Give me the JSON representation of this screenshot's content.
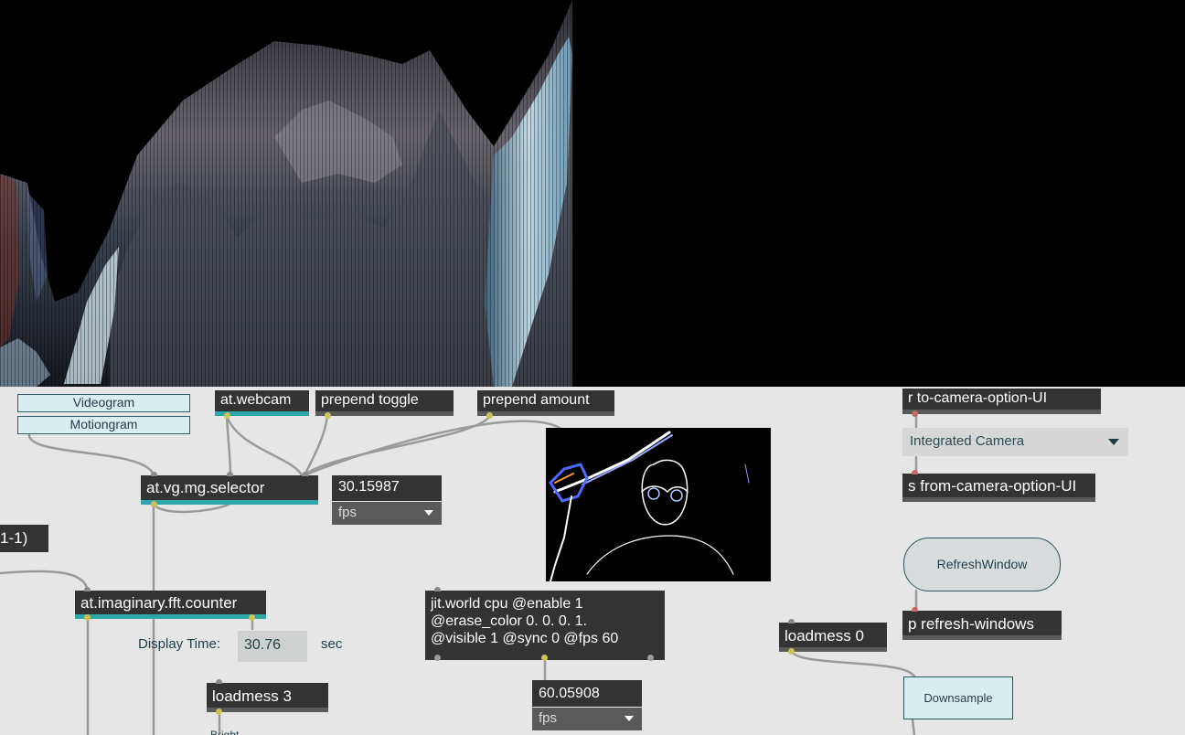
{
  "patch": {
    "videogram_button": "Videogram",
    "motiongram_button": "Motiongram",
    "webcam_object": "at.webcam",
    "prepend_toggle_object": "prepend toggle",
    "prepend_amount_object": "prepend amount",
    "selector_object": "at.vg.mg.selector",
    "selector_fps_value": "30.15987",
    "selector_fps_unit": "fps",
    "partial_object": "1-1)",
    "fft_counter_object": "at.imaginary.fft.counter",
    "display_time_label": "Display Time:",
    "display_time_value": "30.76",
    "display_time_unit": "sec",
    "loadmess_3": "loadmess 3",
    "bottom_partial_label": "Bright",
    "jit_world_line1": "jit.world cpu @enable 1",
    "jit_world_line2": "@erase_color 0. 0. 0. 1.",
    "jit_world_line3": "@visible 1 @sync 0 @fps 60",
    "world_fps_value": "60.05908",
    "world_fps_unit": "fps",
    "receive_object": "r to-camera-option-UI",
    "camera_menu_value": "Integrated Camera",
    "send_object": "s from-camera-option-UI",
    "refresh_button": "RefreshWindow",
    "refresh_windows_object": "p refresh-windows",
    "loadmess_0": "loadmess 0",
    "downsample_button": "Downsample"
  },
  "colors": {
    "patch_background": "#e6e6e6",
    "object_box": "#333333",
    "accent_teal": "#2fa6aa",
    "outlet_yellow": "#c9c25a"
  }
}
